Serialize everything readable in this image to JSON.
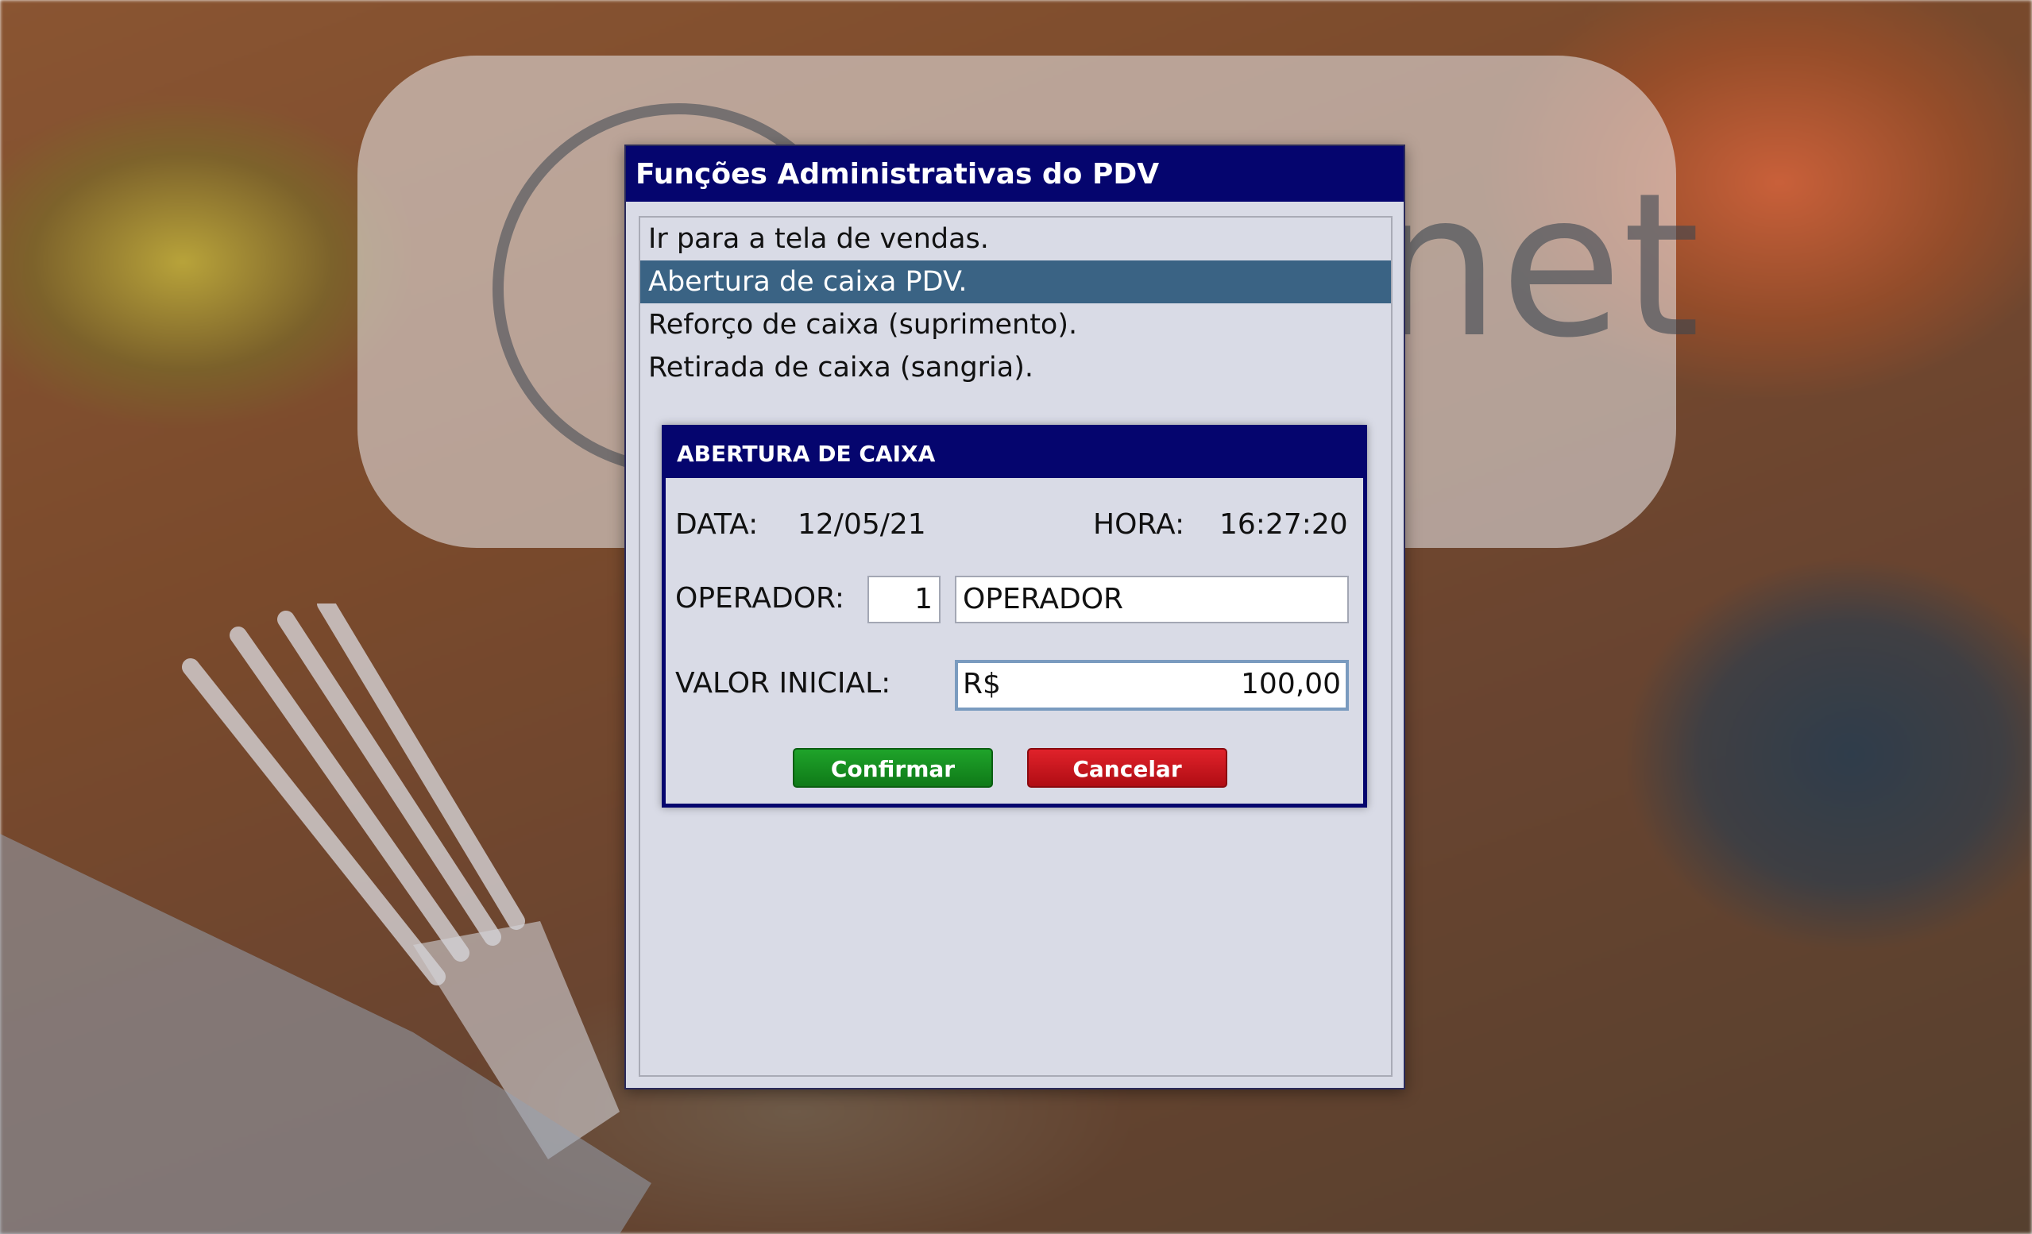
{
  "background": {
    "logo_text": "net"
  },
  "main_dialog": {
    "title": "Funções Administrativas do PDV",
    "menu_items": [
      {
        "label": "Ir para a tela de vendas."
      },
      {
        "label": "Abertura de caixa PDV.",
        "selected": true
      },
      {
        "label": "Reforço de caixa (suprimento)."
      },
      {
        "label": "Retirada de caixa (sangria)."
      }
    ]
  },
  "sub_dialog": {
    "title": "ABERTURA DE CAIXA",
    "date_label": "DATA:",
    "date_value": "12/05/21",
    "time_label": "HORA:",
    "time_value": "16:27:20",
    "operator_label": "OPERADOR:",
    "operator_code": "1",
    "operator_name": "OPERADOR",
    "initial_value_label": "VALOR INICIAL:",
    "currency_prefix": "R$",
    "initial_value": "100,00",
    "confirm_label": "Confirmar",
    "cancel_label": "Cancelar"
  },
  "colors": {
    "title_bar": "#05056e",
    "selected_item": "#3a6384",
    "dialog_bg": "#d9dbe6",
    "confirm": "#1a9a24",
    "cancel": "#d0161e"
  }
}
